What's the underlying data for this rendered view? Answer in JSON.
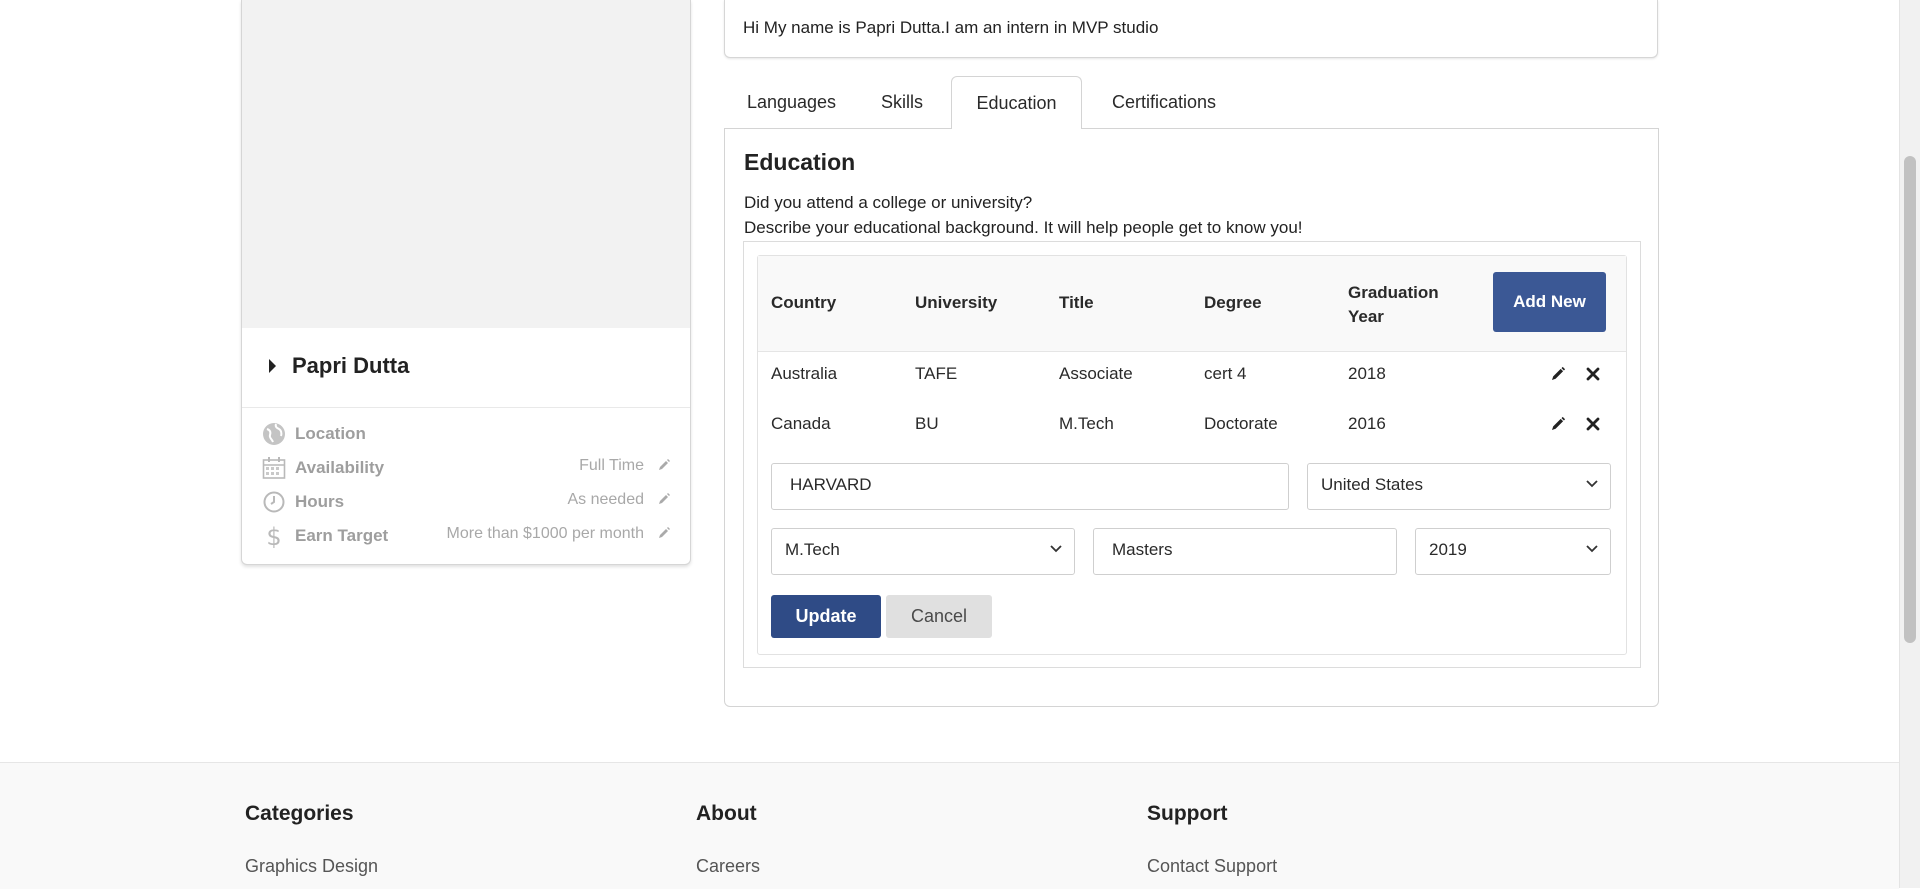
{
  "profile": {
    "name": "Papri Dutta",
    "rows": [
      {
        "icon": "globe-icon",
        "label": "Location",
        "value": ""
      },
      {
        "icon": "calendar-icon",
        "label": "Availability",
        "value": "Full Time"
      },
      {
        "icon": "clock-icon",
        "label": "Hours",
        "value": "As needed"
      },
      {
        "icon": "dollar-icon",
        "label": "Earn Target",
        "value": "More than $1000 per month"
      }
    ]
  },
  "about": {
    "text": "Hi My name is Papri Dutta.I am an intern in MVP studio"
  },
  "tabs": [
    {
      "label": "Languages",
      "active": false
    },
    {
      "label": "Skills",
      "active": false
    },
    {
      "label": "Education",
      "active": true
    },
    {
      "label": "Certifications",
      "active": false
    }
  ],
  "education": {
    "title": "Education",
    "desc1": "Did you attend a college or university?",
    "desc2": "Describe your educational background. It will help people get to know you!",
    "columns": [
      "Country",
      "University",
      "Title",
      "Degree",
      "Graduation Year"
    ],
    "add_label": "Add New",
    "rows": [
      {
        "country": "Australia",
        "university": "TAFE",
        "title": "Associate",
        "degree": "cert 4",
        "year": "2018"
      },
      {
        "country": "Canada",
        "university": "BU",
        "title": "M.Tech",
        "degree": "Doctorate",
        "year": "2016"
      }
    ],
    "form": {
      "university": "HARVARD",
      "country": "United States",
      "title": "M.Tech",
      "degree": "Masters",
      "year": "2019",
      "update_label": "Update",
      "cancel_label": "Cancel"
    }
  },
  "footer": {
    "columns": [
      {
        "heading": "Categories",
        "link": "Graphics Design"
      },
      {
        "heading": "About",
        "link": "Careers"
      },
      {
        "heading": "Support",
        "link": "Contact Support"
      }
    ]
  },
  "colors": {
    "primary": "#3b5895",
    "update": "#2f4b86",
    "cancel": "#e0e0e0"
  }
}
